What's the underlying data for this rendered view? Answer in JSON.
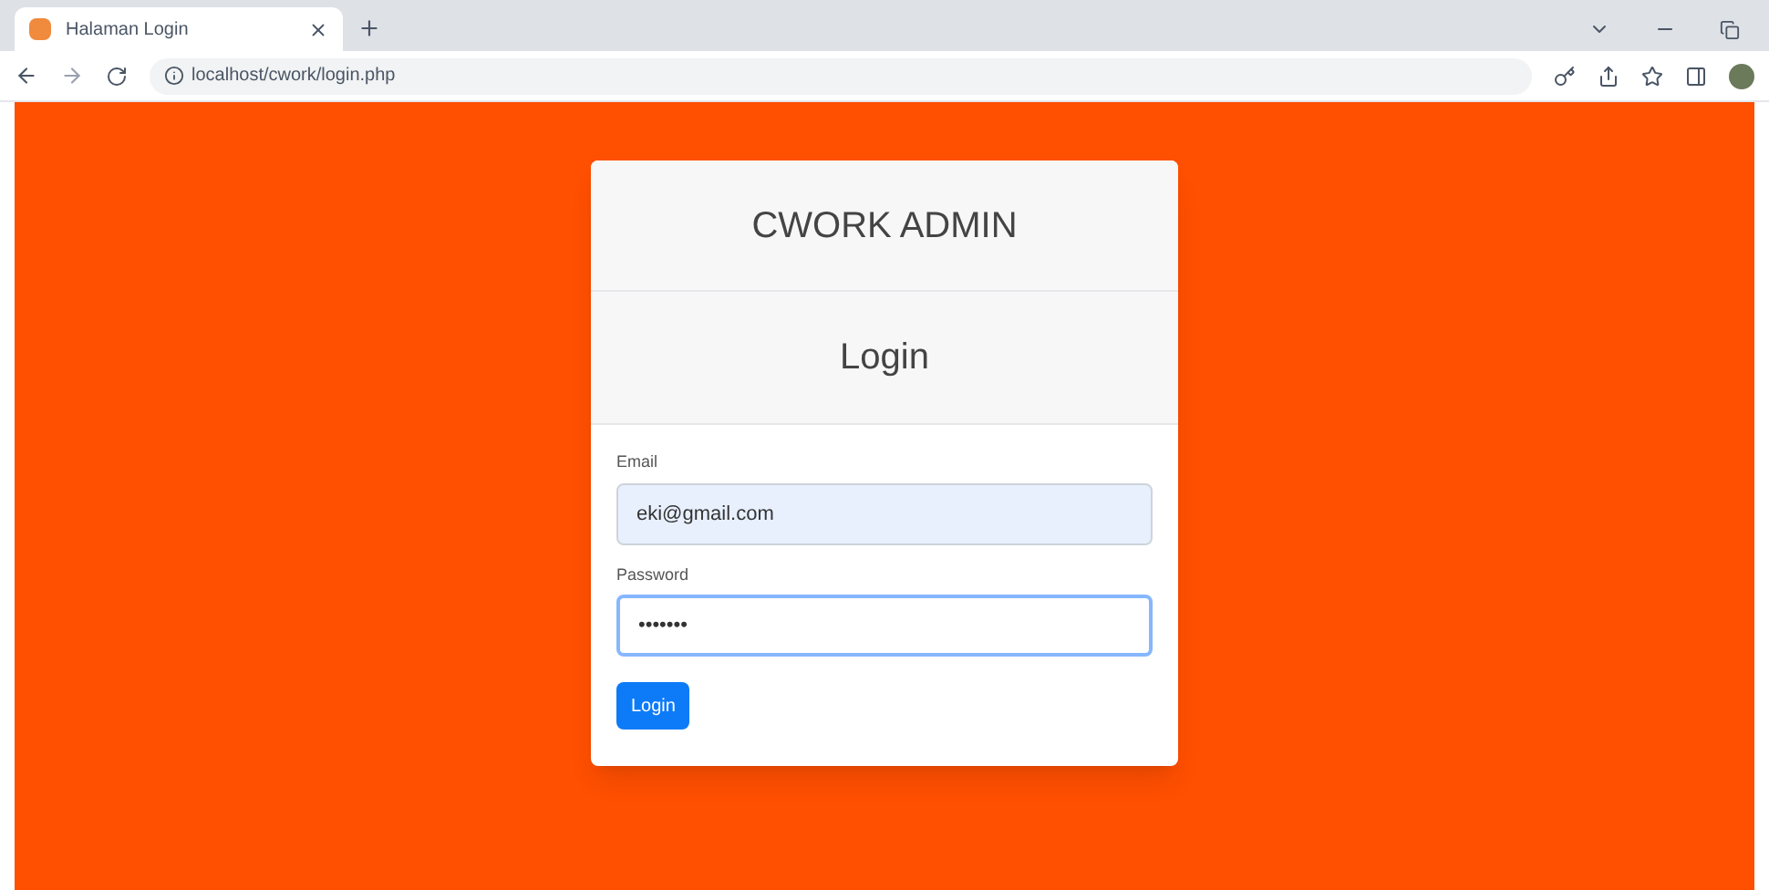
{
  "browser": {
    "tab": {
      "title": "Halaman Login"
    },
    "url": "localhost/cwork/login.php"
  },
  "card": {
    "brand": "CWORK ADMIN",
    "heading": "Login",
    "fields": [
      {
        "label": "Email",
        "value": "eki@gmail.com",
        "autofilled": true,
        "focused": false
      },
      {
        "label": "Password",
        "value": "•••••••",
        "autofilled": false,
        "focused": true
      }
    ],
    "button": "Login"
  }
}
